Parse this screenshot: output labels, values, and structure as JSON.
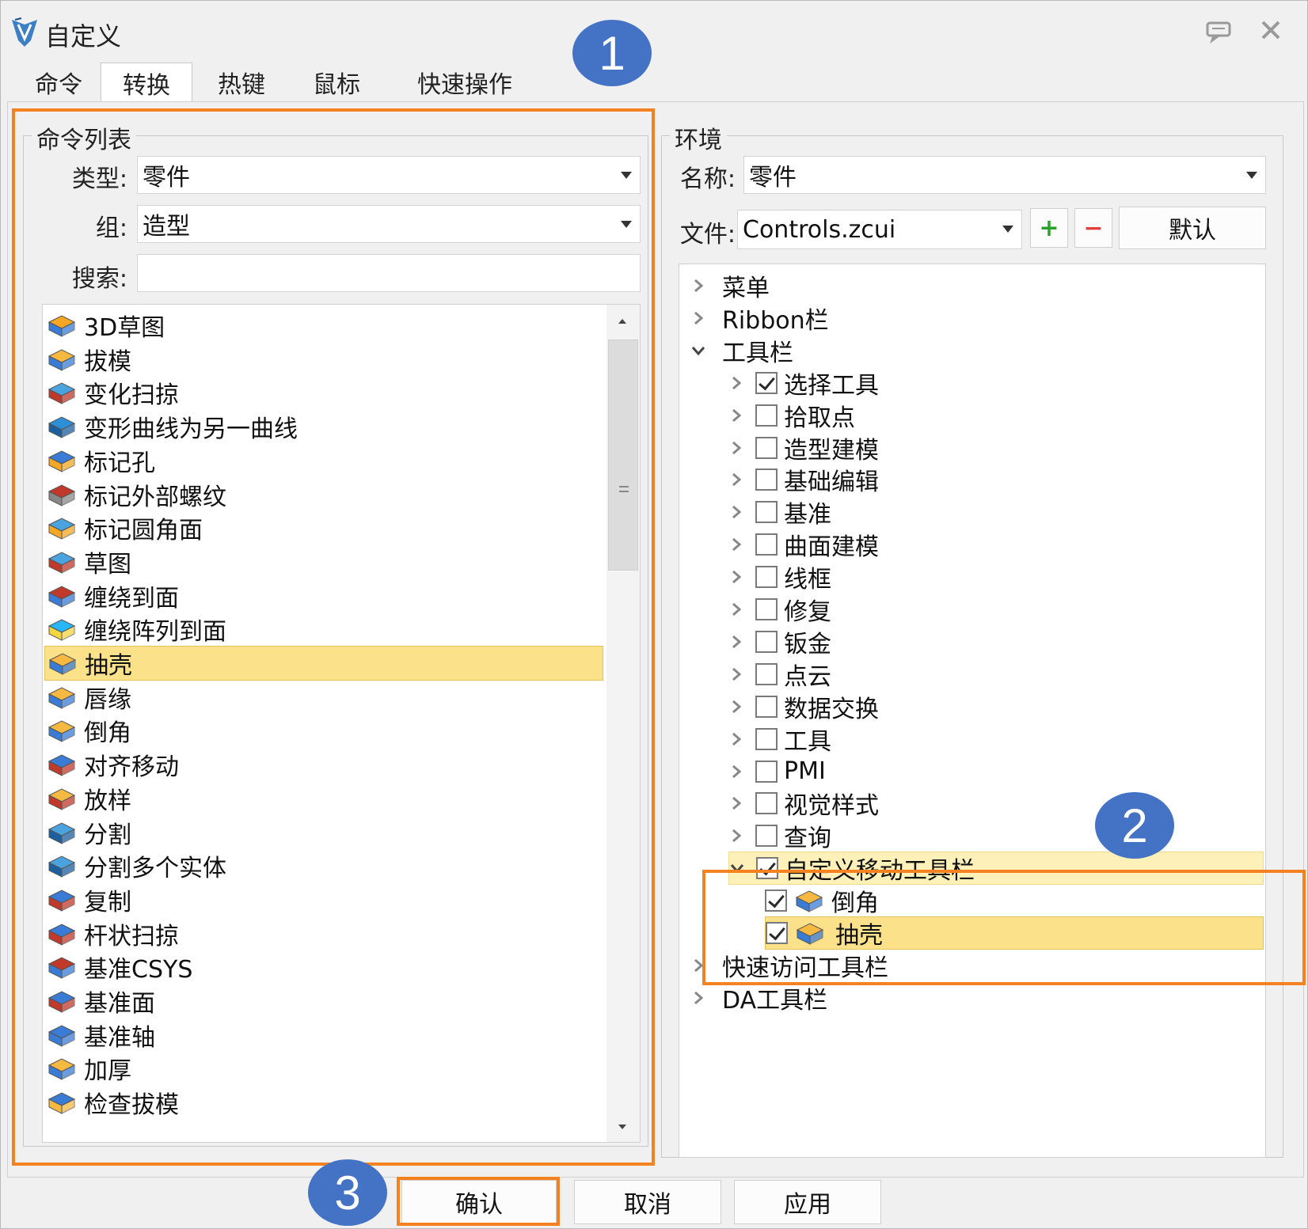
{
  "window": {
    "title": "自定义",
    "tabs": [
      "命令",
      "转换",
      "热键",
      "鼠标",
      "快速操作"
    ],
    "active_tab": "转换"
  },
  "command_list": {
    "group_title": "命令列表",
    "type_label": "类型:",
    "type_value": "零件",
    "group_label": "组:",
    "group_value": "造型",
    "search_label": "搜索:",
    "search_value": "",
    "items": [
      {
        "label": "3D草图",
        "icon": "3d-sketch-icon"
      },
      {
        "label": "拔模",
        "icon": "draft-icon"
      },
      {
        "label": "变化扫掠",
        "icon": "variable-sweep-icon"
      },
      {
        "label": "变形曲线为另一曲线",
        "icon": "curve-deform-icon"
      },
      {
        "label": "标记孔",
        "icon": "mark-hole-icon"
      },
      {
        "label": "标记外部螺纹",
        "icon": "mark-thread-icon"
      },
      {
        "label": "标记圆角面",
        "icon": "mark-fillet-icon"
      },
      {
        "label": "草图",
        "icon": "sketch-icon"
      },
      {
        "label": "缠绕到面",
        "icon": "wrap-to-face-icon"
      },
      {
        "label": "缠绕阵列到面",
        "icon": "wrap-pattern-icon"
      },
      {
        "label": "抽壳",
        "icon": "shell-icon",
        "selected": true
      },
      {
        "label": "唇缘",
        "icon": "lip-icon"
      },
      {
        "label": "倒角",
        "icon": "chamfer-icon"
      },
      {
        "label": "对齐移动",
        "icon": "align-move-icon"
      },
      {
        "label": "放样",
        "icon": "loft-icon"
      },
      {
        "label": "分割",
        "icon": "split-icon"
      },
      {
        "label": "分割多个实体",
        "icon": "split-multi-icon"
      },
      {
        "label": "复制",
        "icon": "copy-icon"
      },
      {
        "label": "杆状扫掠",
        "icon": "rod-sweep-icon"
      },
      {
        "label": "基准CSYS",
        "icon": "datum-csys-icon"
      },
      {
        "label": "基准面",
        "icon": "datum-plane-icon"
      },
      {
        "label": "基准轴",
        "icon": "datum-axis-icon"
      },
      {
        "label": "加厚",
        "icon": "thicken-icon"
      },
      {
        "label": "检查拔模",
        "icon": "check-draft-icon"
      }
    ]
  },
  "environment": {
    "group_title": "环境",
    "name_label": "名称:",
    "name_value": "零件",
    "file_label": "文件:",
    "file_value": "Controls.zcui",
    "add_button": "+",
    "remove_button": "−",
    "default_button": "默认",
    "tree": [
      {
        "label": "菜单",
        "level": 0,
        "expanded": false
      },
      {
        "label": "Ribbon栏",
        "level": 0,
        "expanded": false
      },
      {
        "label": "工具栏",
        "level": 0,
        "expanded": true
      },
      {
        "label": "选择工具",
        "level": 1,
        "checked": true
      },
      {
        "label": "拾取点",
        "level": 1,
        "checked": false
      },
      {
        "label": "造型建模",
        "level": 1,
        "checked": false
      },
      {
        "label": "基础编辑",
        "level": 1,
        "checked": false
      },
      {
        "label": "基准",
        "level": 1,
        "checked": false
      },
      {
        "label": "曲面建模",
        "level": 1,
        "checked": false
      },
      {
        "label": "线框",
        "level": 1,
        "checked": false
      },
      {
        "label": "修复",
        "level": 1,
        "checked": false
      },
      {
        "label": "钣金",
        "level": 1,
        "checked": false
      },
      {
        "label": "点云",
        "level": 1,
        "checked": false
      },
      {
        "label": "数据交换",
        "level": 1,
        "checked": false
      },
      {
        "label": "工具",
        "level": 1,
        "checked": false
      },
      {
        "label": "PMI",
        "level": 1,
        "checked": false
      },
      {
        "label": "视觉样式",
        "level": 1,
        "checked": false
      },
      {
        "label": "查询",
        "level": 1,
        "checked": false
      },
      {
        "label": "自定义移动工具栏",
        "level": 1,
        "checked": true,
        "expanded": true
      },
      {
        "label": "倒角",
        "level": 2,
        "checked": true,
        "icon": "chamfer-icon"
      },
      {
        "label": "抽壳",
        "level": 2,
        "checked": true,
        "icon": "shell-icon",
        "selected": true
      },
      {
        "label": "快速访问工具栏",
        "level": 0,
        "expanded": false
      },
      {
        "label": "DA工具栏",
        "level": 0,
        "expanded": false
      }
    ]
  },
  "footer": {
    "ok": "确认",
    "cancel": "取消",
    "apply": "应用"
  },
  "annotations": {
    "badge1": "1",
    "badge2": "2",
    "badge3": "3",
    "accent_color": "#f58220",
    "badge_color": "#4472c4",
    "selection_color": "#fbe28a"
  }
}
